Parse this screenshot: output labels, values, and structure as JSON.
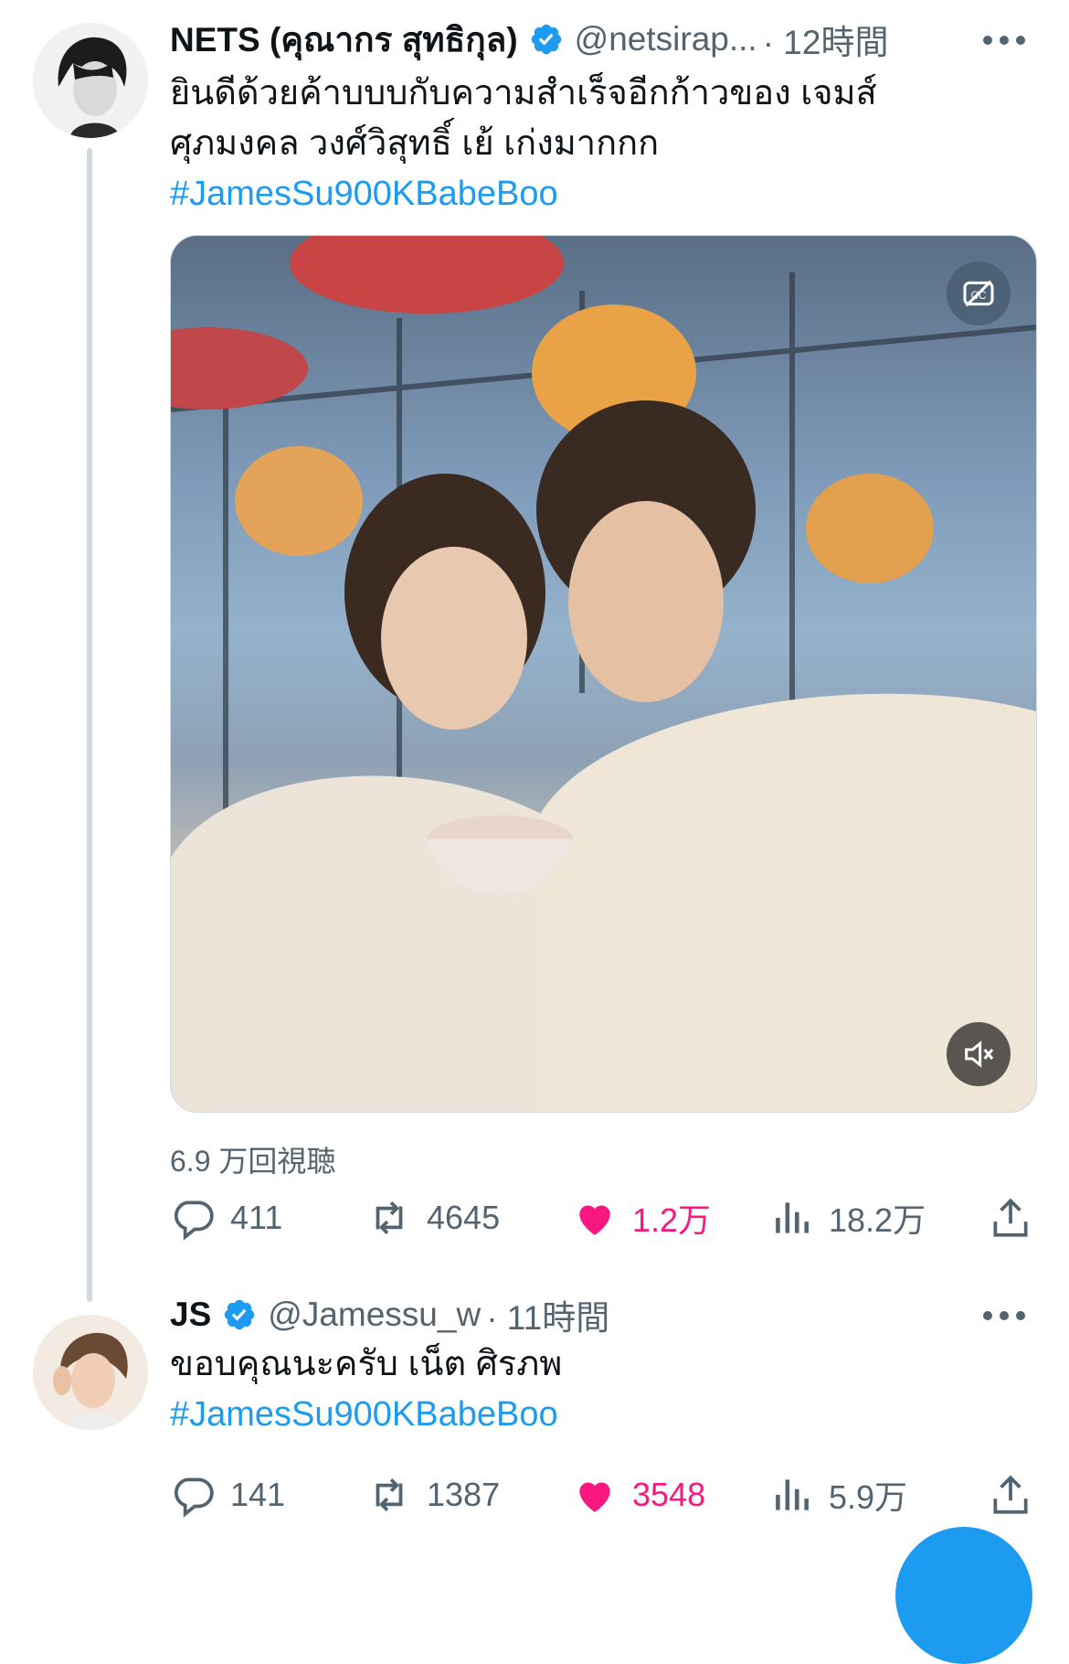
{
  "tweets": [
    {
      "author_name": "NETS (คุณากร สุทธิกุล)",
      "handle": "@netsirap...",
      "time": "· 12時間",
      "text_lines": [
        "ยินดีด้วยค้าบบบกับความสำเร็จอีกก้าวของ เจมส์",
        "ศุภมงคล วงศ์วิสุทธิ์ เย้ เก่งมากกก"
      ],
      "hashtag": "#JamesSu900KBabeBoo",
      "views": "6.9 万回視聴",
      "replies": "411",
      "retweets": "4645",
      "likes": "1.2万",
      "analytics": "18.2万"
    },
    {
      "author_name": "JS",
      "handle": "@Jamessu_w",
      "time": "· 11時間",
      "text_lines": [
        "ขอบคุณนะครับ เน็ต ศิรภพ"
      ],
      "hashtag": "#JamesSu900KBabeBoo",
      "replies": "141",
      "retweets": "1387",
      "likes": "3548",
      "analytics": "5.9万"
    }
  ],
  "icons": {
    "verified": "verified-badge-icon",
    "more": "more-icon",
    "captions": "captions-off-icon",
    "mute": "mute-icon",
    "reply": "reply-icon",
    "retweet": "retweet-icon",
    "like": "heart-icon",
    "analytics": "analytics-icon",
    "share": "share-icon"
  },
  "colors": {
    "accent": "#1d9bf0",
    "like": "#f91880",
    "muted": "#536471"
  }
}
